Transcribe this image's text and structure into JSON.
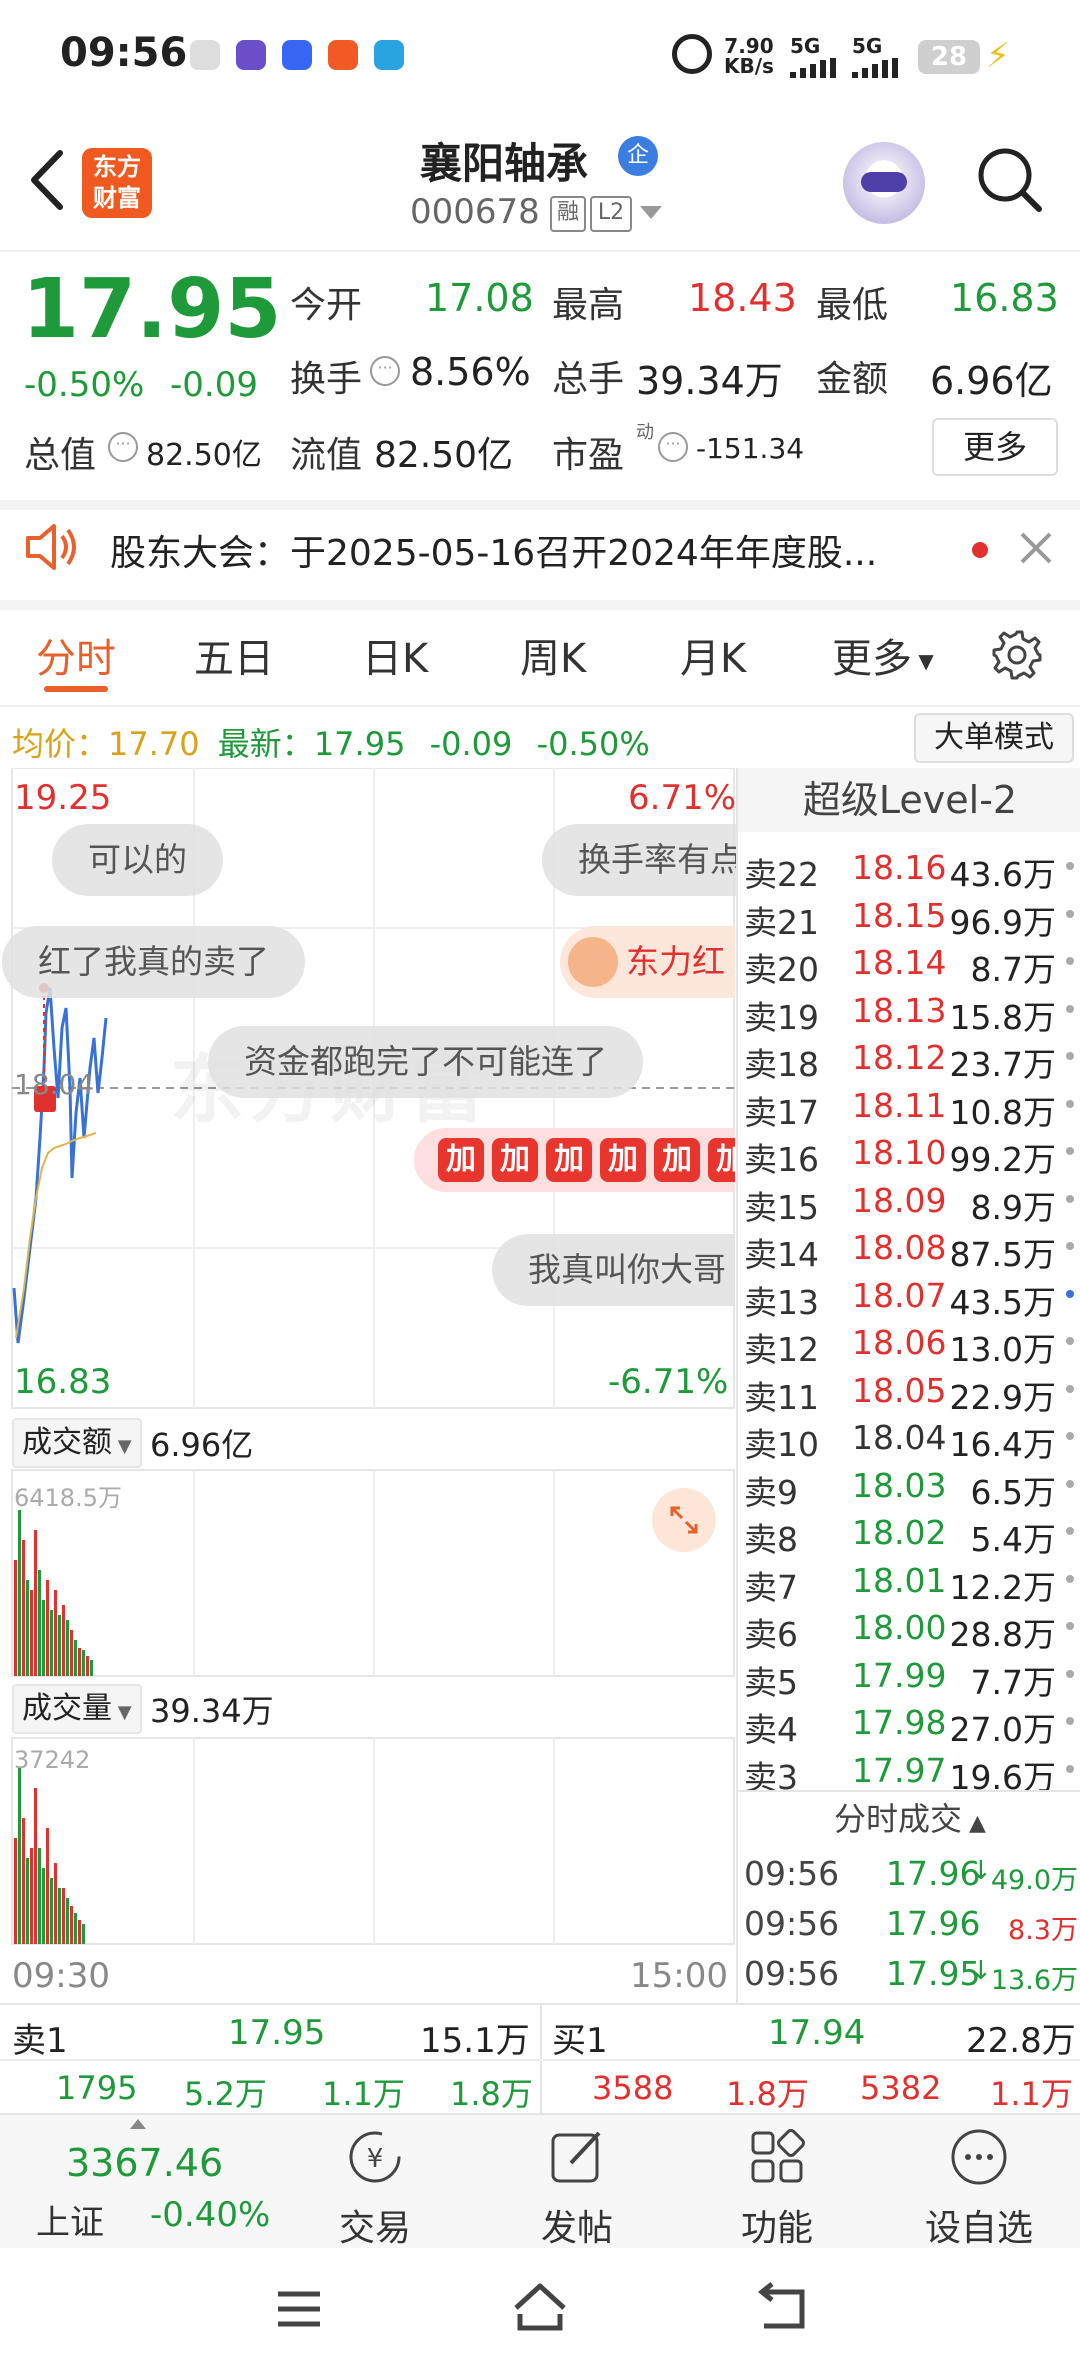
{
  "status_bar": {
    "time": "09:56",
    "net_speed": "7.90",
    "net_speed_unit": "KB/s",
    "sim1": "5G",
    "sim2": "5G",
    "battery": "28"
  },
  "header": {
    "logo_line1": "东方",
    "logo_line2": "财富",
    "stock_name": "襄阳轴承",
    "badge_qi": "企",
    "stock_code": "000678",
    "tag_rong": "融",
    "tag_l2": "L2"
  },
  "quote": {
    "price": "17.95",
    "change_pct": "-0.50%",
    "change": "-0.09",
    "open_label": "今开",
    "open": "17.08",
    "high_label": "最高",
    "high": "18.43",
    "low_label": "最低",
    "low": "16.83",
    "turnover_label": "换手",
    "turnover": "8.56%",
    "volume_label": "总手",
    "volume": "39.34万",
    "amount_label": "金额",
    "amount": "6.96亿",
    "mktcap_label": "总值",
    "mktcap": "82.50亿",
    "float_label": "流值",
    "float": "82.50亿",
    "pe_label": "市盈",
    "pe_sup": "动",
    "pe": "-151.34",
    "more_button": "更多"
  },
  "notice": {
    "text": "股东大会：于2025-05-16召开2024年年度股..."
  },
  "tabs": [
    "分时",
    "五日",
    "日K",
    "周K",
    "月K",
    "更多"
  ],
  "info_line": {
    "avg_label": "均价：",
    "avg": "17.70",
    "latest_label": "最新：",
    "latest": "17.95",
    "change": "-0.09",
    "change_pct": "-0.50%",
    "mode_button": "大单模式"
  },
  "chart": {
    "top_price": "19.25",
    "top_pct": "6.71%",
    "bottom_price": "16.83",
    "bottom_pct": "-6.71%",
    "mid_price": "18.04",
    "watermark": "东方财富",
    "amount_label": "成交额",
    "amount_total": "6.96亿",
    "amount_max": "6418.5万",
    "vol_label": "成交量",
    "vol_total": "39.34万",
    "vol_max": "37242",
    "time_start": "09:30",
    "time_end": "15:00",
    "danmaku": [
      "可以的",
      "换手率有点",
      "红了我真的卖了",
      "东力红",
      "资金都跑完了不可能连了",
      "我真叫你大哥"
    ],
    "jia": "加"
  },
  "order_book": {
    "title": "超级Level-2",
    "rows": [
      {
        "label": "卖22",
        "price": "18.16",
        "vol": "43.6万",
        "pc": "red"
      },
      {
        "label": "卖21",
        "price": "18.15",
        "vol": "96.9万",
        "pc": "red"
      },
      {
        "label": "卖20",
        "price": "18.14",
        "vol": "8.7万",
        "pc": "red"
      },
      {
        "label": "卖19",
        "price": "18.13",
        "vol": "15.8万",
        "pc": "red"
      },
      {
        "label": "卖18",
        "price": "18.12",
        "vol": "23.7万",
        "pc": "red"
      },
      {
        "label": "卖17",
        "price": "18.11",
        "vol": "10.8万",
        "pc": "red"
      },
      {
        "label": "卖16",
        "price": "18.10",
        "vol": "99.2万",
        "pc": "red"
      },
      {
        "label": "卖15",
        "price": "18.09",
        "vol": "8.9万",
        "pc": "red"
      },
      {
        "label": "卖14",
        "price": "18.08",
        "vol": "87.5万",
        "pc": "red"
      },
      {
        "label": "卖13",
        "price": "18.07",
        "vol": "43.5万",
        "pc": "red"
      },
      {
        "label": "卖12",
        "price": "18.06",
        "vol": "13.0万",
        "pc": "red"
      },
      {
        "label": "卖11",
        "price": "18.05",
        "vol": "22.9万",
        "pc": "red"
      },
      {
        "label": "卖10",
        "price": "18.04",
        "vol": "16.4万",
        "pc": "gray"
      },
      {
        "label": "卖9",
        "price": "18.03",
        "vol": "6.5万",
        "pc": "green"
      },
      {
        "label": "卖8",
        "price": "18.02",
        "vol": "5.4万",
        "pc": "green"
      },
      {
        "label": "卖7",
        "price": "18.01",
        "vol": "12.2万",
        "pc": "green"
      },
      {
        "label": "卖6",
        "price": "18.00",
        "vol": "28.8万",
        "pc": "green"
      },
      {
        "label": "卖5",
        "price": "17.99",
        "vol": "7.7万",
        "pc": "green"
      },
      {
        "label": "卖4",
        "price": "17.98",
        "vol": "27.0万",
        "pc": "green"
      },
      {
        "label": "卖3",
        "price": "17.97",
        "vol": "19.6万",
        "pc": "green"
      }
    ],
    "ticks_title": "分时成交",
    "ticks": [
      {
        "time": "09:56",
        "price": "17.96",
        "arrow": "↓",
        "vol": "49.0万",
        "pc": "green",
        "vc": "green"
      },
      {
        "time": "09:56",
        "price": "17.96",
        "arrow": "",
        "vol": "8.3万",
        "pc": "green",
        "vc": "red"
      },
      {
        "time": "09:56",
        "price": "17.95",
        "arrow": "↓",
        "vol": "13.6万",
        "pc": "green",
        "vc": "green"
      }
    ]
  },
  "bottom_quote": {
    "sell1_label": "卖1",
    "sell1_price": "17.95",
    "sell1_vol": "15.1万",
    "buy1_label": "买1",
    "buy1_price": "17.94",
    "buy1_vol": "22.8万",
    "sell_detail": [
      "1795",
      "5.2万",
      "1.1万",
      "1.8万"
    ],
    "buy_detail": [
      "3588",
      "1.8万",
      "5382",
      "1.1万"
    ]
  },
  "bottom_nav": {
    "index_value": "3367.46",
    "index_name": "上证",
    "index_change": "-0.40%",
    "items": [
      "交易",
      "发帖",
      "功能",
      "设自选"
    ]
  },
  "colors": {
    "up": "#e0312f",
    "down": "#1e9a3a",
    "accent": "#e8612c"
  }
}
